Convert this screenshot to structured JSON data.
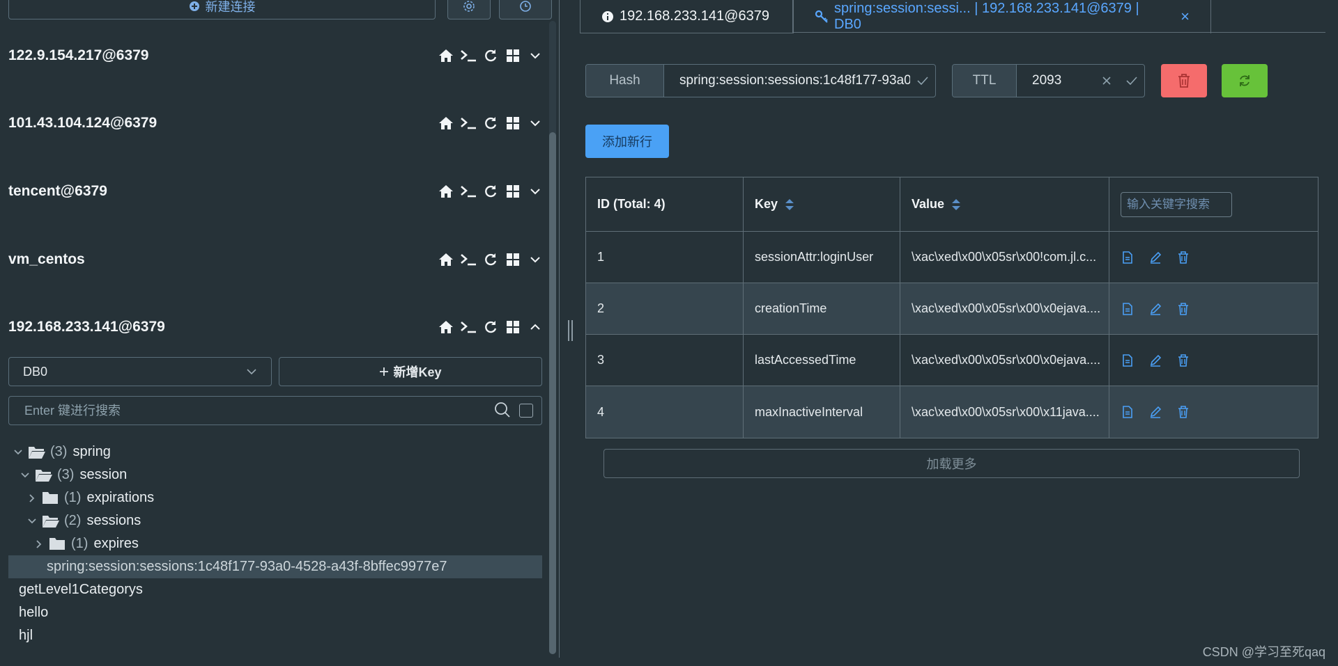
{
  "toolbar": {
    "new_connection_label": "新建连接"
  },
  "connections": [
    {
      "name": "122.9.154.217@6379",
      "expanded": false
    },
    {
      "name": "101.43.104.124@6379",
      "expanded": false
    },
    {
      "name": "tencent@6379",
      "expanded": false
    },
    {
      "name": "vm_centos",
      "expanded": false
    },
    {
      "name": "192.168.233.141@6379",
      "expanded": true
    }
  ],
  "db_select": {
    "value": "DB0"
  },
  "new_key": {
    "label": "新增Key"
  },
  "key_search": {
    "placeholder": "Enter 键进行搜索"
  },
  "tree": [
    {
      "count": "(3)",
      "name": "spring"
    },
    {
      "count": "(3)",
      "name": "session"
    },
    {
      "count": "(1)",
      "name": "expirations"
    },
    {
      "count": "(2)",
      "name": "sessions"
    },
    {
      "count": "(1)",
      "name": "expires"
    },
    {
      "name": "spring:session:sessions:1c48f177-93a0-4528-a43f-8bffec9977e7"
    },
    {
      "name": "getLevel1Categorys"
    },
    {
      "name": "hello"
    },
    {
      "name": "hjl"
    }
  ],
  "tabs": [
    {
      "label": "192.168.233.141@6379"
    },
    {
      "label": "spring:session:sessi... | 192.168.233.141@6379 | DB0",
      "close": "×"
    }
  ],
  "key_detail": {
    "type": "Hash",
    "key_name": "spring:session:sessions:1c48f177-93a0",
    "ttl_label": "TTL",
    "ttl_value": "2093"
  },
  "add_row_label": "添加新行",
  "table": {
    "headers": {
      "id": "ID (Total: 4)",
      "key": "Key",
      "value": "Value",
      "search_placeholder": "输入关键字搜索"
    },
    "rows": [
      {
        "id": "1",
        "key": "sessionAttr:loginUser",
        "value": "\\xac\\xed\\x00\\x05sr\\x00!com.jl.c..."
      },
      {
        "id": "2",
        "key": "creationTime",
        "value": "\\xac\\xed\\x00\\x05sr\\x00\\x0ejava...."
      },
      {
        "id": "3",
        "key": "lastAccessedTime",
        "value": "\\xac\\xed\\x00\\x05sr\\x00\\x0ejava...."
      },
      {
        "id": "4",
        "key": "maxInactiveInterval",
        "value": "\\xac\\xed\\x00\\x05sr\\x00\\x11java...."
      }
    ]
  },
  "load_more_label": "加载更多",
  "watermark": "CSDN @学习至死qaq",
  "colors": {
    "accent": "#4aa1f5",
    "delete": "#f56c6c",
    "refresh": "#67c23a",
    "background": "#263238"
  }
}
